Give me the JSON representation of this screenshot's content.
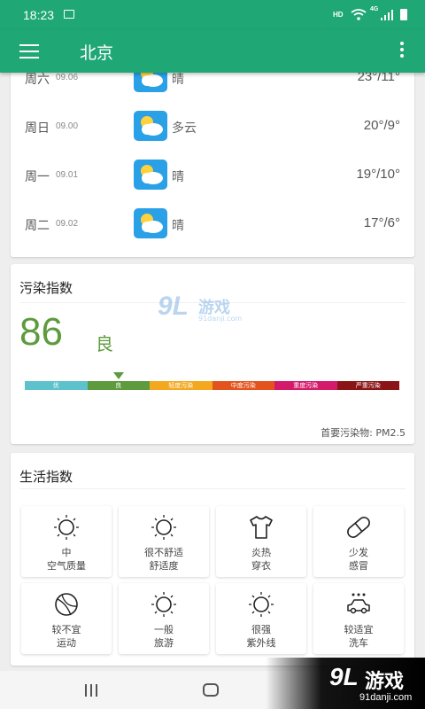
{
  "status_bar": {
    "time": "18:23",
    "hd": "HD",
    "network": "4G"
  },
  "toolbar": {
    "title": "北京"
  },
  "forecast": [
    {
      "day": "周六",
      "date": "09.06",
      "condition": "晴",
      "temp": "23°/11°",
      "icon": "sunny-cloud-icon"
    },
    {
      "day": "周日",
      "date": "09.00",
      "condition": "多云",
      "temp": "20°/9°",
      "icon": "sunny-cloud-icon"
    },
    {
      "day": "周一",
      "date": "09.01",
      "condition": "晴",
      "temp": "19°/10°",
      "icon": "sunny-cloud-icon"
    },
    {
      "day": "周二",
      "date": "09.02",
      "condition": "晴",
      "temp": "17°/6°",
      "icon": "sunny-cloud-icon"
    }
  ],
  "aqi": {
    "title": "污染指数",
    "value": "86",
    "level": "良",
    "scale": [
      "优",
      "良",
      "轻度污染",
      "中度污染",
      "重度污染",
      "严重污染"
    ],
    "scale_colors": [
      "#5ec2cc",
      "#5d9b3e",
      "#f3a820",
      "#e3531e",
      "#d41b6b",
      "#8b1516"
    ],
    "current_index": 1,
    "primary_pollutant": "首要污染物: PM2.5"
  },
  "life": {
    "title": "生活指数",
    "items": [
      {
        "l1": "中",
        "l2": "空气质量",
        "icon": "sun-icon"
      },
      {
        "l1": "很不舒适",
        "l2": "舒适度",
        "icon": "sun-icon"
      },
      {
        "l1": "炎热",
        "l2": "穿衣",
        "icon": "tshirt-icon"
      },
      {
        "l1": "少发",
        "l2": "感冒",
        "icon": "pill-icon"
      },
      {
        "l1": "较不宜",
        "l2": "运动",
        "icon": "basketball-icon"
      },
      {
        "l1": "一般",
        "l2": "旅游",
        "icon": "sun-icon"
      },
      {
        "l1": "很强",
        "l2": "紫外线",
        "icon": "sun-icon"
      },
      {
        "l1": "较适宜",
        "l2": "洗车",
        "icon": "car-wash-icon"
      }
    ]
  },
  "watermark": {
    "brand": "游戏",
    "logo": "9L",
    "url": "91danji.com",
    "url_small": "91danji.com"
  }
}
